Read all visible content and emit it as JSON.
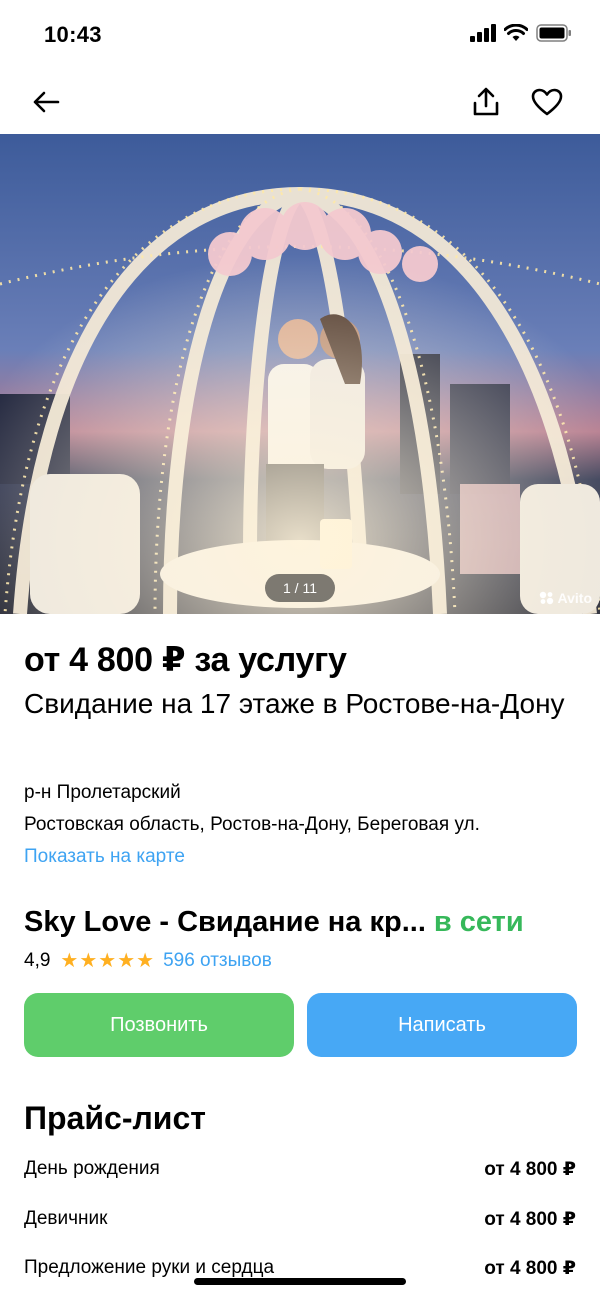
{
  "status_bar": {
    "time": "10:43"
  },
  "gallery": {
    "counter": "1 / 11",
    "watermark": "Avito"
  },
  "listing": {
    "price": "от 4 800 ₽ за услугу",
    "title": "Свидание на 17 этаже в Ростове-на-Дону",
    "district": "р-н Пролетарский",
    "address": "Ростовская область, Ростов-на-Дону, Береговая ул.",
    "map_link": "Показать на карте"
  },
  "seller": {
    "name": "Sky Love - Свидание на кр...",
    "status": "в сети",
    "rating": "4,9",
    "stars": "★★★★★",
    "reviews": "596 отзывов"
  },
  "actions": {
    "call": "Позвонить",
    "write": "Написать"
  },
  "price_list": {
    "title": "Прайс-лист",
    "items": [
      {
        "name": "День рождения",
        "price": "от 4 800 ₽"
      },
      {
        "name": "Девичник",
        "price": "от 4 800 ₽"
      },
      {
        "name": "Предложение руки и сердца",
        "price": "от 4 800 ₽"
      }
    ]
  },
  "colors": {
    "link": "#3ea3f2",
    "online": "#36b85a",
    "call_button": "#5fcd6b",
    "write_button": "#47a8f5",
    "stars": "#ffb021"
  },
  "icons": [
    "back-arrow-icon",
    "share-icon",
    "favorite-heart-icon",
    "signal-icon",
    "wifi-icon",
    "battery-icon"
  ]
}
